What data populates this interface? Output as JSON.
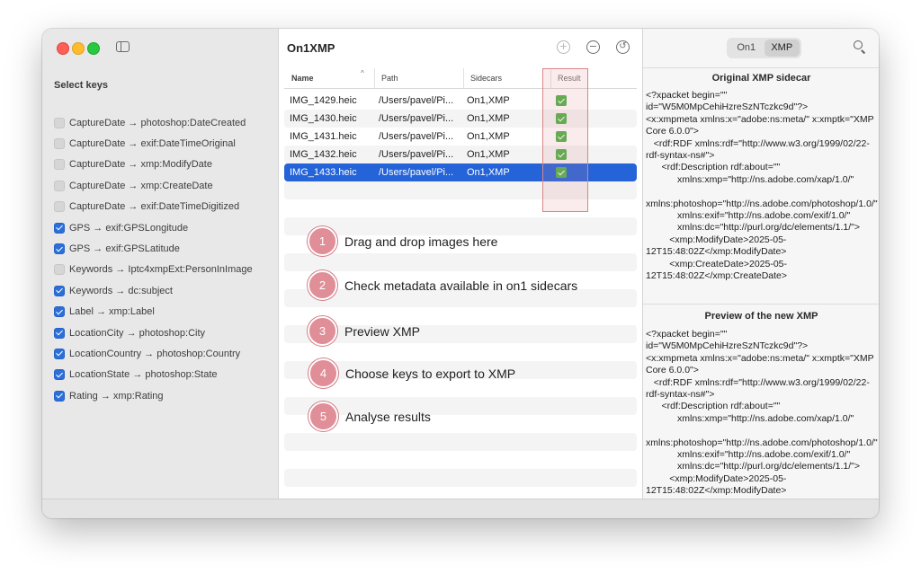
{
  "app": {
    "title": "On1XMP"
  },
  "sidebar": {
    "title": "Select keys",
    "keys": [
      {
        "label": "CaptureDate → photoshop:DateCreated",
        "checked": false
      },
      {
        "label": "CaptureDate → exif:DateTimeOriginal",
        "checked": false
      },
      {
        "label": "CaptureDate → xmp:ModifyDate",
        "checked": false
      },
      {
        "label": "CaptureDate → xmp:CreateDate",
        "checked": false
      },
      {
        "label": "CaptureDate → exif:DateTimeDigitized",
        "checked": false
      },
      {
        "label": "GPS → exif:GPSLongitude",
        "checked": true
      },
      {
        "label": "GPS → exif:GPSLatitude",
        "checked": true
      },
      {
        "label": "Keywords → Iptc4xmpExt:PersonInImage",
        "checked": false
      },
      {
        "label": "Keywords → dc:subject",
        "checked": true
      },
      {
        "label": "Label → xmp:Label",
        "checked": true
      },
      {
        "label": "LocationCity → photoshop:City",
        "checked": true
      },
      {
        "label": "LocationCountry → photoshop:Country",
        "checked": true
      },
      {
        "label": "LocationState → photoshop:State",
        "checked": true
      },
      {
        "label": "Rating → xmp:Rating",
        "checked": true
      }
    ]
  },
  "toolbar": {
    "add_icon": "plus-circle-icon",
    "remove_icon": "minus-circle-icon",
    "undo_icon": "undo-circle-icon"
  },
  "table": {
    "columns": {
      "name": "Name",
      "path": "Path",
      "sidecars": "Sidecars",
      "result": "Result"
    },
    "rows": [
      {
        "name": "IMG_1429.heic",
        "path": "/Users/pavel/Pi...",
        "sidecars": "On1,XMP",
        "result": "ok",
        "selected": false
      },
      {
        "name": "IMG_1430.heic",
        "path": "/Users/pavel/Pi...",
        "sidecars": "On1,XMP",
        "result": "ok",
        "selected": false
      },
      {
        "name": "IMG_1431.heic",
        "path": "/Users/pavel/Pi...",
        "sidecars": "On1,XMP",
        "result": "ok",
        "selected": false
      },
      {
        "name": "IMG_1432.heic",
        "path": "/Users/pavel/Pi...",
        "sidecars": "On1,XMP",
        "result": "ok",
        "selected": false
      },
      {
        "name": "IMG_1433.heic",
        "path": "/Users/pavel/Pi...",
        "sidecars": "On1,XMP",
        "result": "ok",
        "selected": true
      }
    ]
  },
  "steps": [
    {
      "number": "1",
      "text": "Drag and drop images here"
    },
    {
      "number": "2",
      "text": "Check metadata available in on1 sidecars"
    },
    {
      "number": "3",
      "text": "Preview XMP"
    },
    {
      "number": "4",
      "text": "Choose keys to export to XMP"
    },
    {
      "number": "5",
      "text": "Analyse results"
    }
  ],
  "right_panel": {
    "segments": {
      "on1": "On1",
      "xmp": "XMP",
      "active": "XMP"
    },
    "original": {
      "title": "Original XMP sidecar",
      "text": "<?xpacket begin=\"\" id=\"W5M0MpCehiHzreSzNTczkc9d\"?>\n<x:xmpmeta xmlns:x=\"adobe:ns:meta/\" x:xmptk=\"XMP Core 6.0.0\">\n   <rdf:RDF xmlns:rdf=\"http://www.w3.org/1999/02/22-rdf-syntax-ns#\">\n      <rdf:Description rdf:about=\"\"\n            xmlns:xmp=\"http://ns.adobe.com/xap/1.0/\"\n            xmlns:photoshop=\"http://ns.adobe.com/photoshop/1.0/\"\n            xmlns:exif=\"http://ns.adobe.com/exif/1.0/\"\n            xmlns:dc=\"http://purl.org/dc/elements/1.1/\">\n         <xmp:ModifyDate>2025-05-12T15:48:02Z</xmp:ModifyDate>\n         <xmp:CreateDate>2025-05-12T15:48:02Z</xmp:CreateDate>"
    },
    "preview": {
      "title": "Preview of the new XMP",
      "text": "<?xpacket begin=\"\" id=\"W5M0MpCehiHzreSzNTczkc9d\"?>\n<x:xmpmeta xmlns:x=\"adobe:ns:meta/\" x:xmptk=\"XMP Core 6.0.0\">\n   <rdf:RDF xmlns:rdf=\"http://www.w3.org/1999/02/22-rdf-syntax-ns#\">\n      <rdf:Description rdf:about=\"\"\n            xmlns:xmp=\"http://ns.adobe.com/xap/1.0/\"\n            xmlns:photoshop=\"http://ns.adobe.com/photoshop/1.0/\"\n            xmlns:exif=\"http://ns.adobe.com/exif/1.0/\"\n            xmlns:dc=\"http://purl.org/dc/elements/1.1/\">\n         <xmp:ModifyDate>2025-05-12T15:48:02Z</xmp:ModifyDate>"
    }
  },
  "colors": {
    "selection": "#2563d8",
    "checkbox_on": "#2b6fd9",
    "result_ok": "#4fb34a",
    "step_badge": "#e08e97",
    "highlight_border": "#d7868a"
  }
}
